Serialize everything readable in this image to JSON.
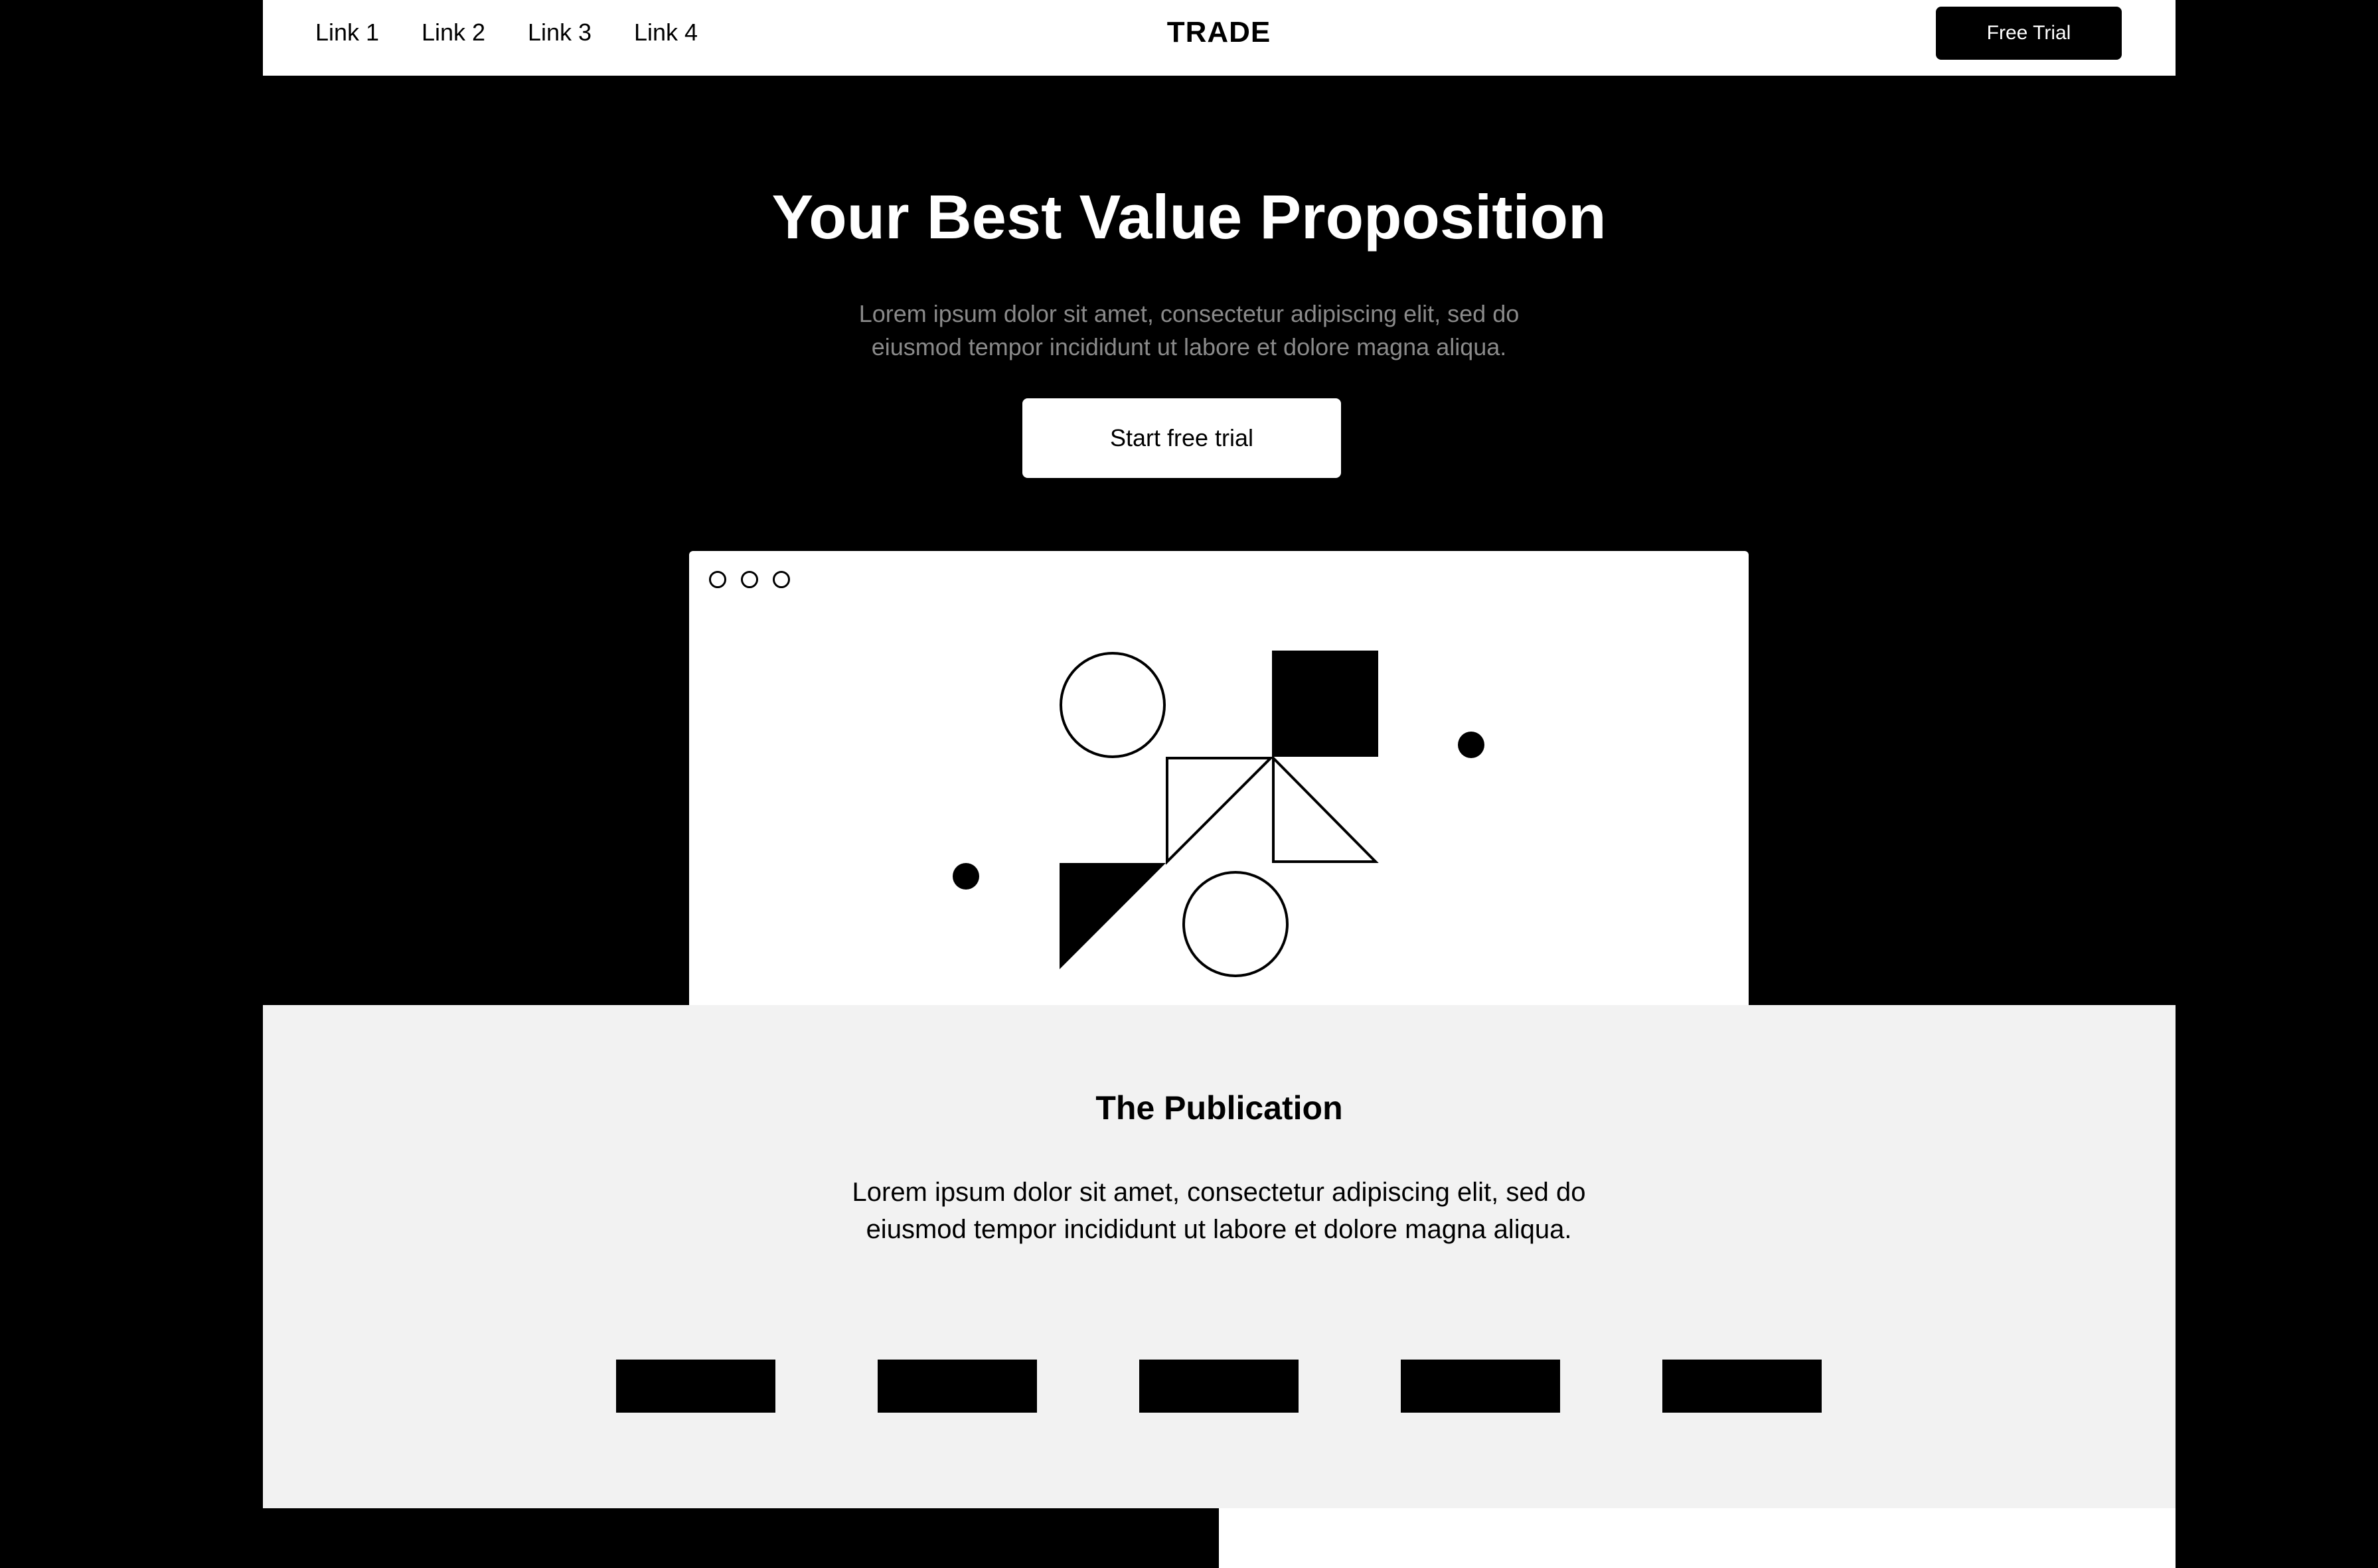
{
  "nav": {
    "links": [
      "Link 1",
      "Link 2",
      "Link 3",
      "Link 4"
    ],
    "brand": "TRADE",
    "cta_label": "Free Trial"
  },
  "hero": {
    "title": "Your Best Value Proposition",
    "subtitle": "Lorem ipsum dolor sit amet, consectetur adipiscing elit, sed do eiusmod tempor incididunt ut labore et dolore magna aliqua.",
    "cta_label": "Start free trial"
  },
  "publication": {
    "title": "The Publication",
    "text": "Lorem ipsum dolor sit amet, consectetur adipiscing elit, sed do eiusmod tempor incididunt ut labore et dolore magna aliqua.",
    "logo_count": 5
  },
  "colors": {
    "background": "#000000",
    "surface": "#ffffff",
    "section": "#f2f2f2",
    "muted_text": "#8a8a8a"
  }
}
